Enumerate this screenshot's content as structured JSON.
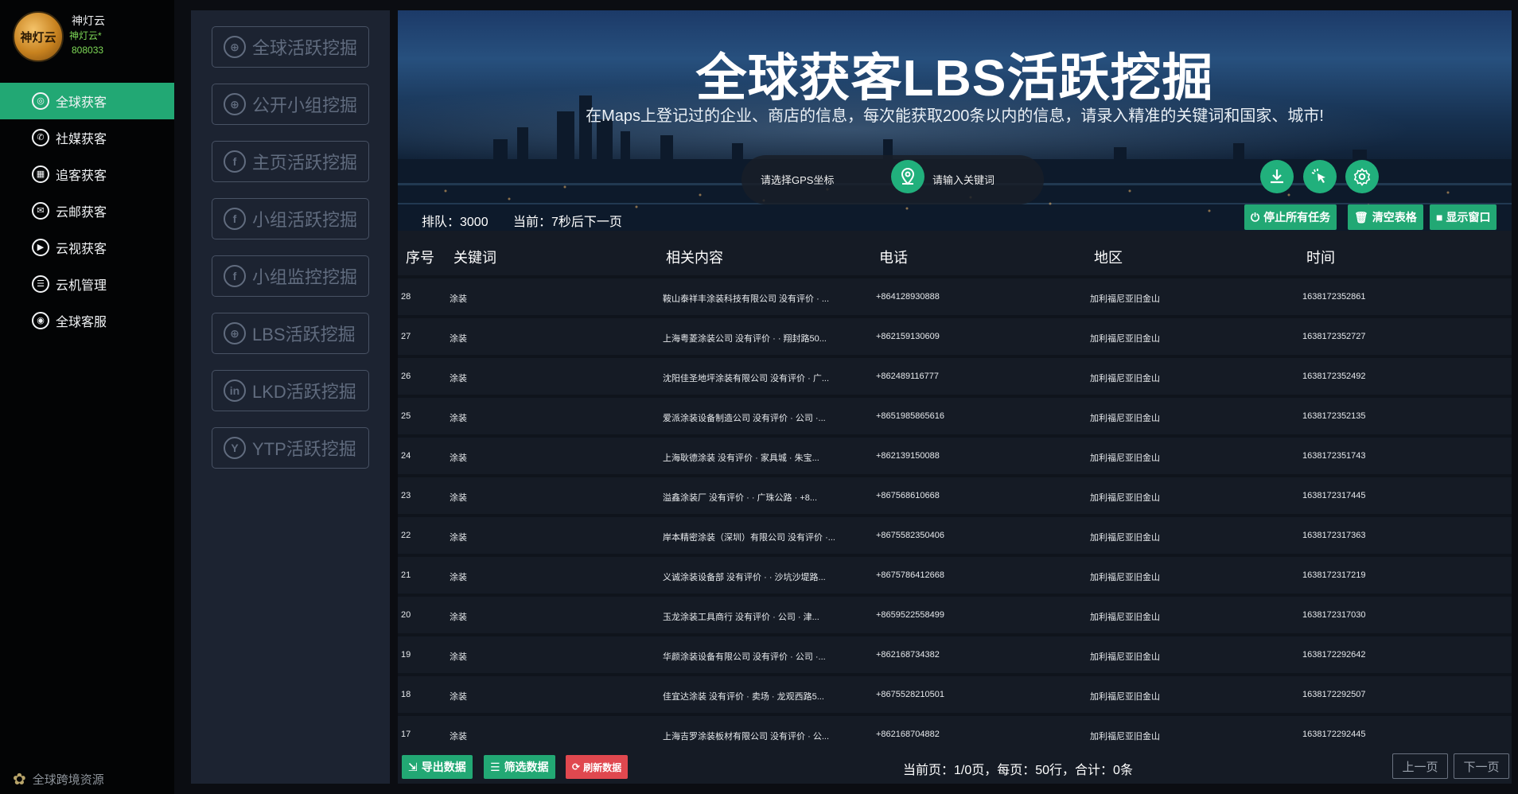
{
  "brand": {
    "logo_text": "神灯云",
    "name": "神灯云",
    "sub": "神灯云*",
    "id": "808033"
  },
  "sidebar": {
    "items": [
      {
        "label": "全球获客",
        "icon": "globe-icon",
        "glyph": "◎",
        "active": true
      },
      {
        "label": "社媒获客",
        "icon": "whatsapp-icon",
        "glyph": "✆",
        "active": false
      },
      {
        "label": "追客获客",
        "icon": "grid-icon",
        "glyph": "▦",
        "active": false
      },
      {
        "label": "云邮获客",
        "icon": "mail-icon",
        "glyph": "✉",
        "active": false
      },
      {
        "label": "云视获客",
        "icon": "play-icon",
        "glyph": "▶",
        "active": false
      },
      {
        "label": "云机管理",
        "icon": "phone-icon",
        "glyph": "☰",
        "active": false
      },
      {
        "label": "全球客服",
        "icon": "chat-icon",
        "glyph": "◉",
        "active": false
      }
    ],
    "footer": "全球跨境资源"
  },
  "modules": [
    {
      "label": "全球活跃挖掘",
      "icon": "globe-icon",
      "glyph": "⊕"
    },
    {
      "label": "公开小组挖掘",
      "icon": "globe-icon",
      "glyph": "⊕"
    },
    {
      "label": "主页活跃挖掘",
      "icon": "facebook-icon",
      "glyph": "f"
    },
    {
      "label": "小组活跃挖掘",
      "icon": "facebook-icon",
      "glyph": "f"
    },
    {
      "label": "小组监控挖掘",
      "icon": "facebook-icon",
      "glyph": "f"
    },
    {
      "label": "LBS活跃挖掘",
      "icon": "globe-icon",
      "glyph": "⊕"
    },
    {
      "label": "LKD活跃挖掘",
      "icon": "linkedin-icon",
      "glyph": "in"
    },
    {
      "label": "YTP活跃挖掘",
      "icon": "youtube-icon",
      "glyph": "Y"
    }
  ],
  "hero": {
    "title": "全球获客LBS活跃挖掘",
    "subtitle": "在Maps上登记过的企业、商店的信息，每次能获取200条以内的信息，请录入精准的关键词和国家、城市!",
    "gps_placeholder": "请选择GPS坐标",
    "keyword_placeholder": "请输入关键词"
  },
  "status": {
    "queue": "排队：3000",
    "current": "当前：7秒后下一页"
  },
  "actions": {
    "stop": "停止所有任务",
    "clear": "清空表格",
    "show": "显示窗口"
  },
  "table": {
    "headers": [
      "序号",
      "关键词",
      "相关内容",
      "电话",
      "地区",
      "时间"
    ],
    "rows": [
      [
        "28",
        "涂装",
        "鞍山泰祥丰涂装科技有限公司 没有评价 · ...",
        "+864128930888",
        "加利福尼亚旧金山",
        "1638172352861"
      ],
      [
        "27",
        "涂装",
        "上海粤菱涂装公司 没有评价 · · 翔封路50...",
        "+862159130609",
        "加利福尼亚旧金山",
        "1638172352727"
      ],
      [
        "26",
        "涂装",
        "沈阳佳圣地坪涂装有限公司 没有评价 · 广...",
        "+862489116777",
        "加利福尼亚旧金山",
        "1638172352492"
      ],
      [
        "25",
        "涂装",
        "爱派涂装设备制造公司 没有评价 · 公司 ·...",
        "+8651985865616",
        "加利福尼亚旧金山",
        "1638172352135"
      ],
      [
        "24",
        "涂装",
        "上海耿德涂装 没有评价 · 家具城 · 朱宝...",
        "+862139150088",
        "加利福尼亚旧金山",
        "1638172351743"
      ],
      [
        "23",
        "涂装",
        "溢鑫涂装厂 没有评价 · · 广珠公路 · +8...",
        "+867568610668",
        "加利福尼亚旧金山",
        "1638172317445"
      ],
      [
        "22",
        "涂装",
        "岸本精密涂装（深圳）有限公司 没有评价 ·...",
        "+8675582350406",
        "加利福尼亚旧金山",
        "1638172317363"
      ],
      [
        "21",
        "涂装",
        "义诚涂装设备部 没有评价 · · 沙坑沙堤路...",
        "+8675786412668",
        "加利福尼亚旧金山",
        "1638172317219"
      ],
      [
        "20",
        "涂装",
        "玉龙涂装工具商行 没有评价 · 公司 · 津...",
        "+8659522558499",
        "加利福尼亚旧金山",
        "1638172317030"
      ],
      [
        "19",
        "涂装",
        "华颜涂装设备有限公司 没有评价 · 公司 ·...",
        "+862168734382",
        "加利福尼亚旧金山",
        "1638172292642"
      ],
      [
        "18",
        "涂装",
        "佳宜达涂装 没有评价 · 卖场 · 龙观西路5...",
        "+8675528210501",
        "加利福尼亚旧金山",
        "1638172292507"
      ],
      [
        "17",
        "涂装",
        "上海吉罗涂装板材有限公司 没有评价 · 公...",
        "+862168704882",
        "加利福尼亚旧金山",
        "1638172292445"
      ]
    ]
  },
  "bottom": {
    "export": "导出数据",
    "filter": "筛选数据",
    "refresh": "刷新数据",
    "page_info": "当前页：1/0页，每页：50行，合计：0条",
    "prev": "上一页",
    "next": "下一页"
  },
  "colors": {
    "accent": "#22a874",
    "danger": "#e0484f",
    "panel": "#151b25"
  }
}
